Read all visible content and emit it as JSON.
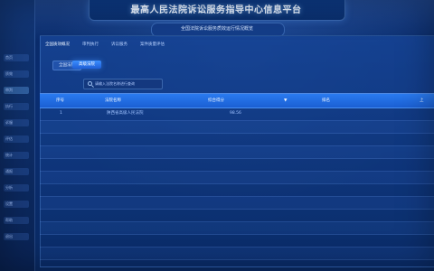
{
  "header": {
    "title": "最高人民法院诉讼服务指导中心信息平台",
    "subtitle": "全国法院诉讼服务质效运行情况概览"
  },
  "tabs": [
    "全国质效概况",
    "审判执行",
    "诉讼服务",
    "案件质量评估"
  ],
  "filters": {
    "btn1": "全国法院",
    "btn2": "高级法院"
  },
  "search": {
    "placeholder": "请输入法院名称进行查询"
  },
  "table": {
    "headers": [
      "序号",
      "法院名称",
      "",
      "综合得分",
      "▼",
      "排名",
      "上"
    ],
    "rows": [
      {
        "index": "1",
        "court": "陕西省高级人民法院",
        "score": "98.56"
      },
      {
        "index": "",
        "court": "",
        "score": ""
      },
      {
        "index": "",
        "court": "",
        "score": ""
      },
      {
        "index": "",
        "court": "",
        "score": ""
      },
      {
        "index": "",
        "court": "",
        "score": ""
      },
      {
        "index": "",
        "court": "",
        "score": ""
      },
      {
        "index": "",
        "court": "",
        "score": ""
      },
      {
        "index": "",
        "court": "",
        "score": ""
      },
      {
        "index": "",
        "court": "",
        "score": ""
      },
      {
        "index": "",
        "court": "",
        "score": ""
      },
      {
        "index": "",
        "court": "",
        "score": ""
      },
      {
        "index": "",
        "court": "",
        "score": ""
      }
    ]
  },
  "sidebar": {
    "items": [
      "首页",
      "质效",
      "审判",
      "执行",
      "诉服",
      "评估",
      "统计",
      "通报",
      "分析",
      "设置",
      "帮助",
      "退出"
    ]
  },
  "colors": {
    "background": "#0b2a66",
    "accent": "#2a7bf0",
    "primary_button": "#3b8fff"
  }
}
